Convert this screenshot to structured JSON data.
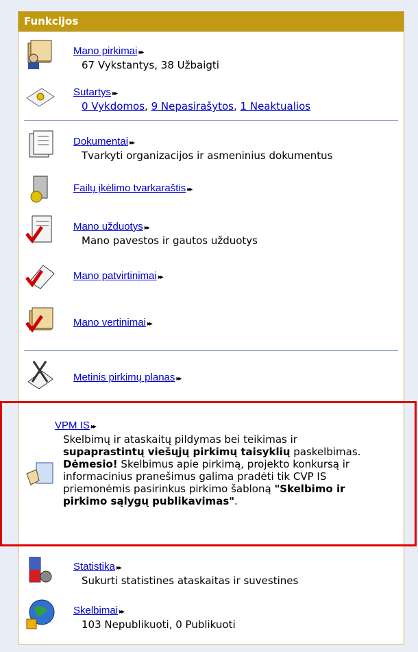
{
  "header": {
    "title": "Funkcijos"
  },
  "items": [
    {
      "title": "Mano pirkimai",
      "desc": "67 Vykstantys, 38 Užbaigti"
    },
    {
      "title": "Sutartys",
      "links": [
        "0 Vykdomos",
        "9 Nepasirašytos",
        "1 Neaktualios"
      ]
    },
    {
      "title": "Dokumentai",
      "desc": "Tvarkyti organizacijos ir asmeninius dokumentus"
    },
    {
      "title": "Failų įkėlimo tvarkaraštis"
    },
    {
      "title": "Mano užduotys",
      "desc": "Mano pavestos ir gautos užduotys"
    },
    {
      "title": "Mano patvirtinimai"
    },
    {
      "title": "Mano vertinimai"
    },
    {
      "title": "Metinis pirkimų planas"
    },
    {
      "title": "Statistika",
      "desc": "Sukurti statistines ataskaitas ir suvestines"
    },
    {
      "title": "Skelbimai",
      "desc": "103 Nepublikuoti,  0 Publikuoti"
    }
  ],
  "vpm": {
    "title": "VPM IS",
    "p1a": "Skelbimų ir ataskaitų pildymas bei teikimas ir",
    "p1b": "supaprastintų viešųjų pirkimų taisyklių",
    "p1c": "paskelbimas.",
    "p2a": "Dėmesio!",
    "p2b": " Skelbimus apie pirkimą, projekto konkursą ir informacinius pranešimus galima pradėti tik CVP IS priemonėmis pasirinkus pirkimo šabloną ",
    "p2c": "\"Skelbimo ir pirkimo sąlygų publikavimas\"",
    "p2d": "."
  },
  "arrow": "▸▸",
  "sep_color": "#7f97bf",
  "highlight_color": "#e00000"
}
